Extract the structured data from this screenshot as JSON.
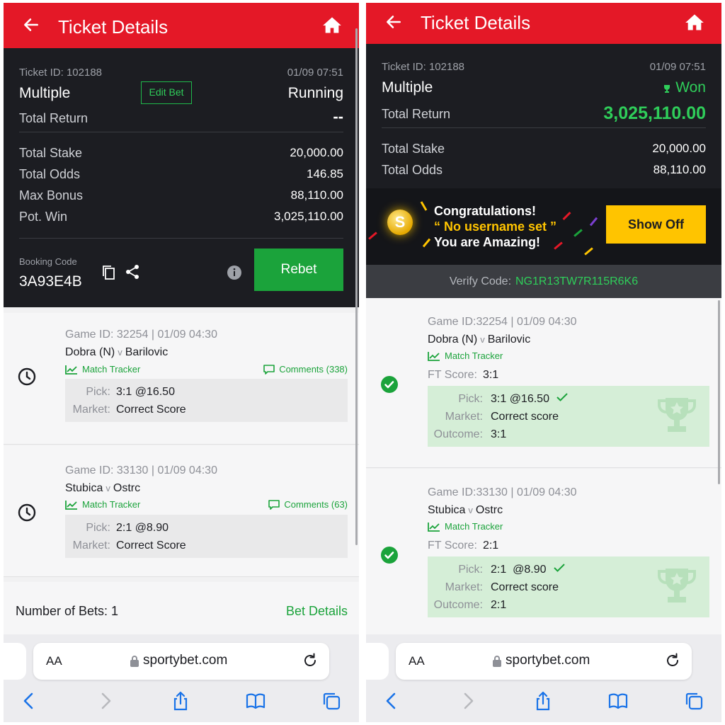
{
  "left": {
    "header": {
      "title": "Ticket Details"
    },
    "summary": {
      "ticket_id": "Ticket ID: 102188",
      "datetime": "01/09 07:51",
      "type": "Multiple",
      "edit_bet": "Edit Bet",
      "status": "Running",
      "total_return_label": "Total Return",
      "total_return_value": "--",
      "rows": [
        {
          "label": "Total Stake",
          "value": "20,000.00"
        },
        {
          "label": "Total Odds",
          "value": "146.85"
        },
        {
          "label": "Max Bonus",
          "value": "88,110.00"
        },
        {
          "label": "Pot. Win",
          "value": "3,025,110.00"
        }
      ],
      "booking_code_label": "Booking Code",
      "booking_code": "3A93E4B",
      "rebet": "Rebet"
    },
    "games": [
      {
        "game_id": "Game ID: 32254 | 01/09 04:30",
        "home": "Dobra (N)",
        "vs": "v",
        "away": "Barilovic",
        "tracker": "Match Tracker",
        "comments": "Comments (338)",
        "pick_label": "Pick:",
        "pick": "3:1 @16.50",
        "market_label": "Market:",
        "market": "Correct Score"
      },
      {
        "game_id": "Game ID: 33130 | 01/09 04:30",
        "home": "Stubica",
        "vs": "v",
        "away": "Ostrc",
        "tracker": "Match Tracker",
        "comments": "Comments (63)",
        "pick_label": "Pick:",
        "pick": "2:1 @8.90",
        "market_label": "Market:",
        "market": "Correct Score"
      }
    ],
    "footer": {
      "bets": "Number of Bets: 1",
      "details": "Bet Details"
    },
    "browser": {
      "aa": "AA",
      "url": "sportybet.com"
    }
  },
  "right": {
    "header": {
      "title": "Ticket Details"
    },
    "summary": {
      "ticket_id": "Ticket ID: 102188",
      "datetime": "01/09 07:51",
      "type": "Multiple",
      "status": "Won",
      "total_return_label": "Total Return",
      "total_return_value": "3,025,110.00",
      "rows": [
        {
          "label": "Total Stake",
          "value": "20,000.00"
        },
        {
          "label": "Total Odds",
          "value": "88,110.00"
        }
      ]
    },
    "promo": {
      "line1": "Congratulations!",
      "line2": "“ No username set ”",
      "line3": "You are Amazing!",
      "coin": "S",
      "show_off": "Show Off"
    },
    "verify": {
      "label": "Verify Code:",
      "code": "NG1R13TW7R115R6K6"
    },
    "games": [
      {
        "game_id": "Game ID:32254 | 01/09 04:30",
        "home": "Dobra (N)",
        "vs": "v",
        "away": "Barilovic",
        "tracker": "Match Tracker",
        "ft_label": "FT Score:",
        "ft": "3:1",
        "pick_label": "Pick:",
        "pick": "3:1 @16.50",
        "market_label": "Market:",
        "market": "Correct score",
        "outcome_label": "Outcome:",
        "outcome": "3:1"
      },
      {
        "game_id": "Game ID:33130 | 01/09 04:30",
        "home": "Stubica",
        "vs": "v",
        "away": "Ostrc",
        "tracker": "Match Tracker",
        "ft_label": "FT Score:",
        "ft": "2:1",
        "pick_label": "Pick:",
        "pick": "2:1  @8.90",
        "market_label": "Market:",
        "market": "Correct score",
        "outcome_label": "Outcome:",
        "outcome": "2:1"
      }
    ],
    "browser": {
      "aa": "AA",
      "url": "sportybet.com"
    }
  },
  "colors": {
    "brand_red": "#e41827",
    "green": "#1ba33b",
    "win_green": "#2fce5a",
    "dark": "#1c1d22",
    "gold": "#ffc400"
  },
  "icons": [
    "back-arrow-icon",
    "home-icon",
    "copy-icon",
    "share-icon",
    "info-icon",
    "clock-icon",
    "check-circle-icon",
    "trophy-icon",
    "chart-icon",
    "comment-icon",
    "lock-icon",
    "reload-icon",
    "chevron-left-icon",
    "chevron-right-icon",
    "share-sheet-icon",
    "book-icon",
    "tabs-icon"
  ]
}
